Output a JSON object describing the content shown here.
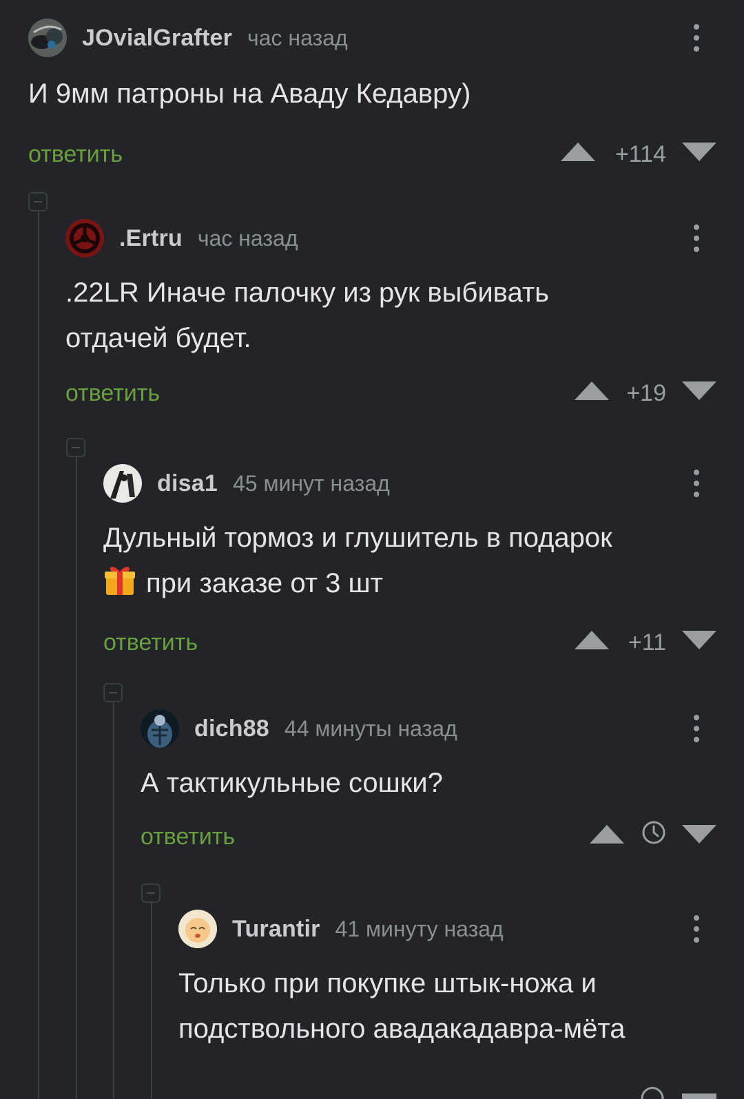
{
  "comments": [
    {
      "user": "JOvialGrafter",
      "time": "час назад",
      "text": "И 9мм патроны на Аваду Кедавру)",
      "reply": "ответить",
      "score": "+114"
    },
    {
      "user": ".Ertru",
      "time": "час назад",
      "text": ".22LR Иначе палочку из рук выбивать отдачей будет.",
      "reply": "ответить",
      "score": "+19"
    },
    {
      "user": "disa1",
      "time": "45 минут назад",
      "text_line1": "Дульный тормоз и глушитель в подарок",
      "text_line2": "при заказе от 3 шт",
      "reply": "ответить",
      "score": "+11"
    },
    {
      "user": "dich88",
      "time": "44 минуты назад",
      "text": "А тактикульные сошки?",
      "reply": "ответить",
      "score": ""
    },
    {
      "user": "Turantir",
      "time": "41 минуту назад",
      "text": "Только при покупке штык-ножа и подствольного авадакадавра-мёта"
    }
  ],
  "colors": {
    "background": "#222428",
    "reply": "#6a9f3e",
    "username": "#c9cbce",
    "meta": "#8b8e93",
    "votes": "#9a9da2"
  },
  "icons": [
    "avatar",
    "more-vertical-icon",
    "upvote-icon",
    "downvote-icon",
    "clock-icon",
    "collapse-icon",
    "gift-emoji"
  ]
}
